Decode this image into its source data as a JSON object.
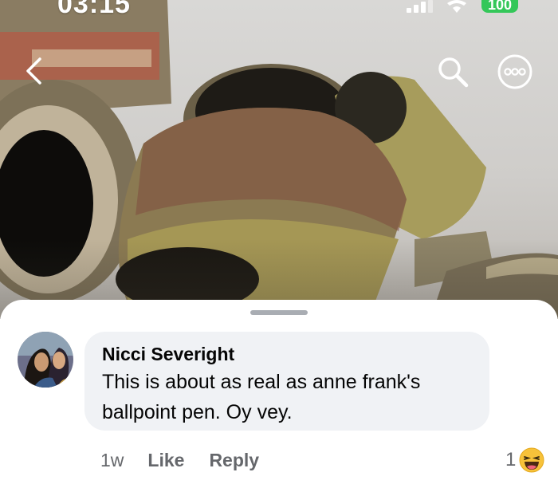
{
  "status_bar": {
    "time": "03:15",
    "battery": "100",
    "battery_color": "#34c759"
  },
  "nav": {
    "back_icon": "chevron-left-icon",
    "search_icon": "magnifier-icon",
    "more_icon": "ellipsis-circle-icon"
  },
  "comment": {
    "author": "Nicci Severight",
    "text_line1": "This is about as real as anne frank's",
    "text_line2": "ballpoint pen. Oy vey.",
    "time_ago": "1w",
    "like_label": "Like",
    "reply_label": "Reply",
    "reaction_count": "1",
    "reaction_icon": "haha-emoji-icon"
  },
  "colors": {
    "bubble": "#f0f2f5",
    "secondary_text": "#65676b",
    "primary_text": "#050505"
  }
}
